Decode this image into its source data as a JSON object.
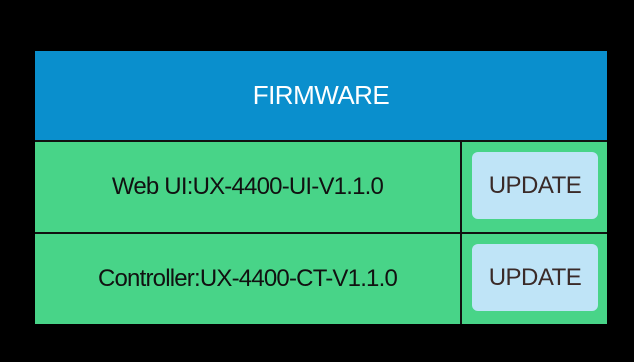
{
  "header": {
    "title": "FIRMWARE"
  },
  "firmware": {
    "items": [
      {
        "label": "Web UI:UX-4400-UI-V1.1.0",
        "button_label": "UPDATE"
      },
      {
        "label": "Controller:UX-4400-CT-V1.1.0",
        "button_label": "UPDATE"
      }
    ]
  },
  "colors": {
    "background": "#000000",
    "header": "#0a8fcd",
    "row": "#48d488",
    "button": "#bfe4f7"
  }
}
